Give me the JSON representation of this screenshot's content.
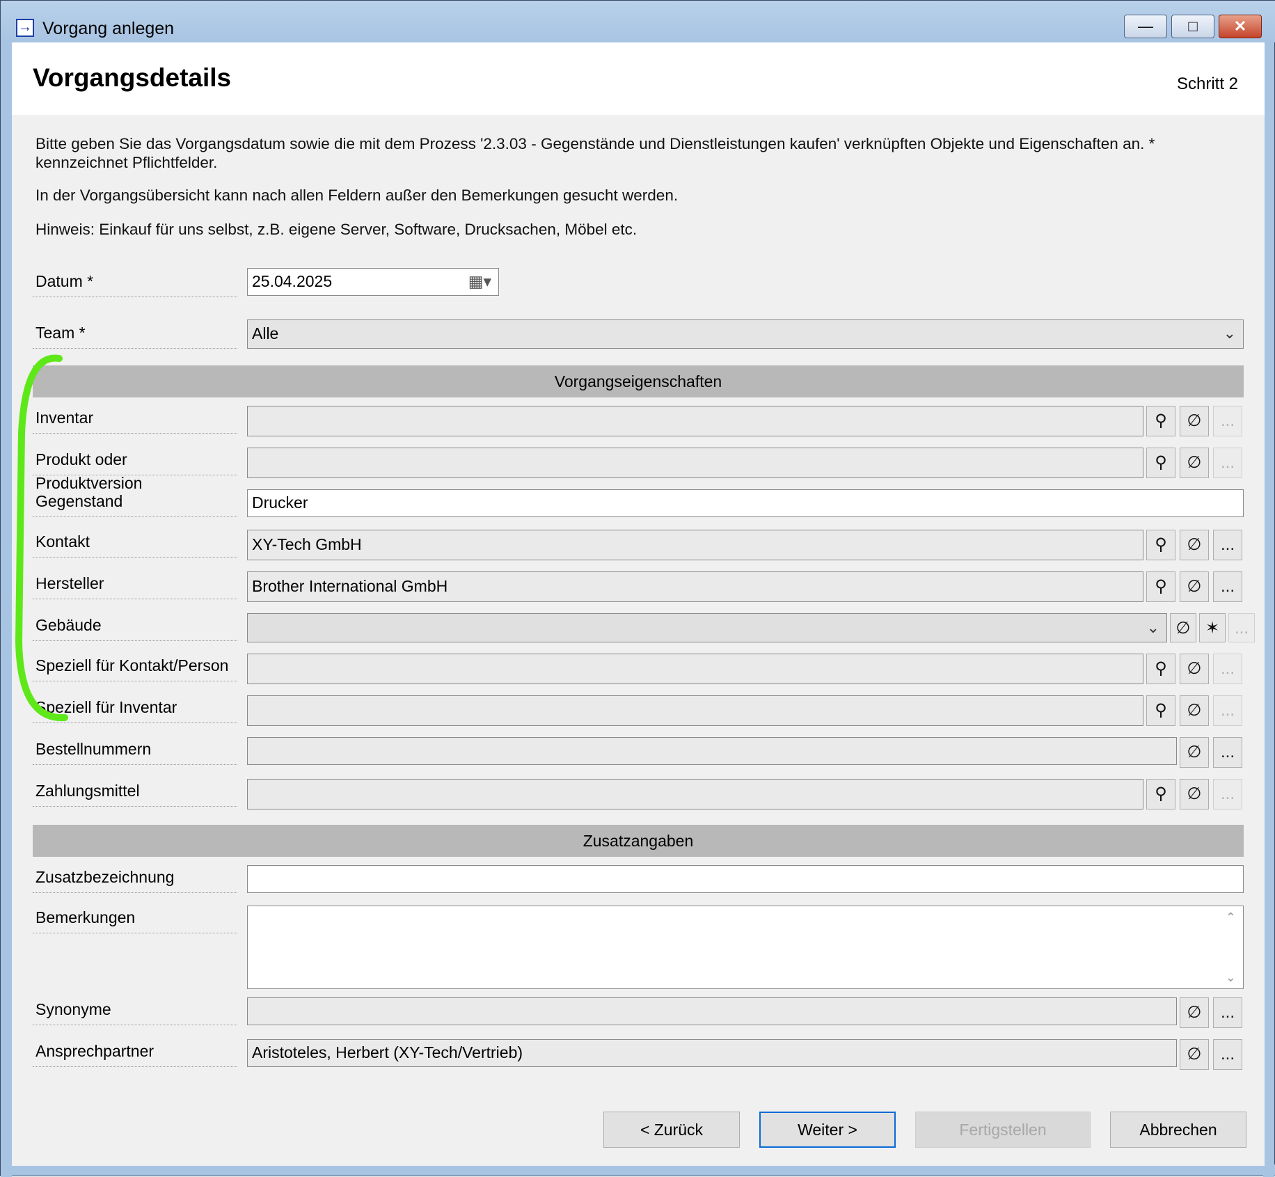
{
  "window": {
    "title": "Vorgang anlegen",
    "minimize": "—",
    "maximize": "□",
    "close": "✕"
  },
  "header": {
    "title": "Vorgangsdetails",
    "step": "Schritt 2"
  },
  "intro": {
    "line1": "Bitte geben Sie das Vorgangsdatum sowie die mit dem Prozess '2.3.03 - Gegenstände und Dienstleistungen kaufen' verknüpften Objekte und Eigenschaften an. *",
    "line2": "kennzeichnet Pflichtfelder.",
    "line3": "In der Vorgangsübersicht kann nach allen Feldern außer den Bemerkungen gesucht werden.",
    "line4": "Hinweis: Einkauf für uns selbst, z.B. eigene Server, Software, Drucksachen, Möbel etc."
  },
  "datum": {
    "label": "Datum *",
    "value": "25.04.2025"
  },
  "team": {
    "label": "Team *",
    "value": "Alle"
  },
  "sections": {
    "props": "Vorgangseigenschaften",
    "extra": "Zusatzangaben"
  },
  "fields": {
    "inventar": {
      "label": "Inventar",
      "value": ""
    },
    "produkt": {
      "label": "Produkt oder Produktversion",
      "value": ""
    },
    "gegenstand": {
      "label": "Gegenstand",
      "value": "Drucker"
    },
    "kontakt": {
      "label": "Kontakt",
      "value": "XY-Tech GmbH"
    },
    "hersteller": {
      "label": "Hersteller",
      "value": "Brother International GmbH"
    },
    "gebaeude": {
      "label": "Gebäude",
      "value": ""
    },
    "speziell_kontakt": {
      "label": "Speziell für Kontakt/Person",
      "value": ""
    },
    "speziell_inventar": {
      "label": "Speziell für Inventar",
      "value": ""
    },
    "bestellnummern": {
      "label": "Bestellnummern",
      "value": ""
    },
    "zahlungsmittel": {
      "label": "Zahlungsmittel",
      "value": ""
    },
    "zusatzbezeichnung": {
      "label": "Zusatzbezeichnung",
      "value": ""
    },
    "bemerkungen": {
      "label": "Bemerkungen",
      "value": ""
    },
    "synonyme": {
      "label": "Synonyme",
      "value": ""
    },
    "ansprechpartner": {
      "label": "Ansprechpartner",
      "value": "Aristoteles, Herbert (XY-Tech/Vertrieb)"
    }
  },
  "icons": {
    "pick": "⚲",
    "clear": "∅",
    "more": "...",
    "star": "✶",
    "dropdown": "⌄",
    "calendar": "▦▾",
    "scroll_up": "⌃",
    "scroll_down": "⌄"
  },
  "buttons": {
    "back": "< Zurück",
    "next": "Weiter >",
    "finish": "Fertigstellen",
    "cancel": "Abbrechen"
  },
  "colors": {
    "highlight": "#5ee81a",
    "default_button_border": "#0a6ad6"
  }
}
